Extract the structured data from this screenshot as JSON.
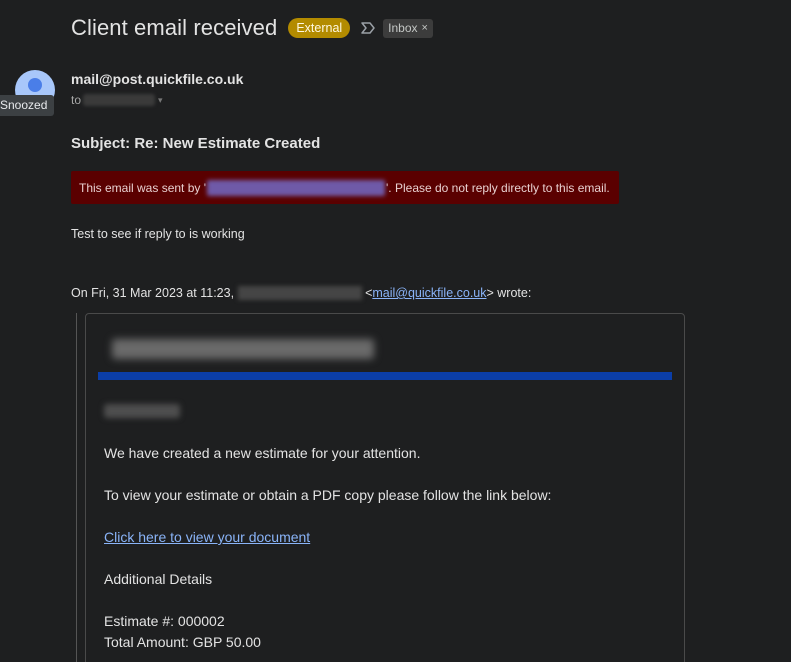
{
  "header": {
    "title": "Client email received",
    "external_badge": "External",
    "label": "Inbox",
    "label_remove": "×"
  },
  "tooltip": {
    "snoozed": "Snoozed"
  },
  "message": {
    "sender": "mail@post.quickfile.co.uk",
    "to_prefix": "to",
    "subject": "Subject: Re: New Estimate Created",
    "warning_prefix": "This email was sent by '",
    "warning_suffix": "'. Please do not reply directly to this email.",
    "body": "Test to see if reply to is working",
    "quote_intro": "On Fri, 31 Mar 2023 at 11:23,",
    "quote_email_open": "<",
    "quote_email": "mail@quickfile.co.uk",
    "quote_email_close": "> wrote:"
  },
  "estimate": {
    "line1": "We have created a new estimate for your attention.",
    "line2": "To view your estimate or obtain a PDF copy please follow the link below:",
    "link": "Click here to view your document",
    "details_heading": "Additional Details",
    "estimate_number": "Estimate #: 000002",
    "total_amount": "Total Amount: GBP 50.00"
  },
  "colors": {
    "external_badge": "#b38b00",
    "warning_bg": "#5a0000",
    "blue_rule": "#0b3ea8",
    "link": "#8ab4f8"
  }
}
